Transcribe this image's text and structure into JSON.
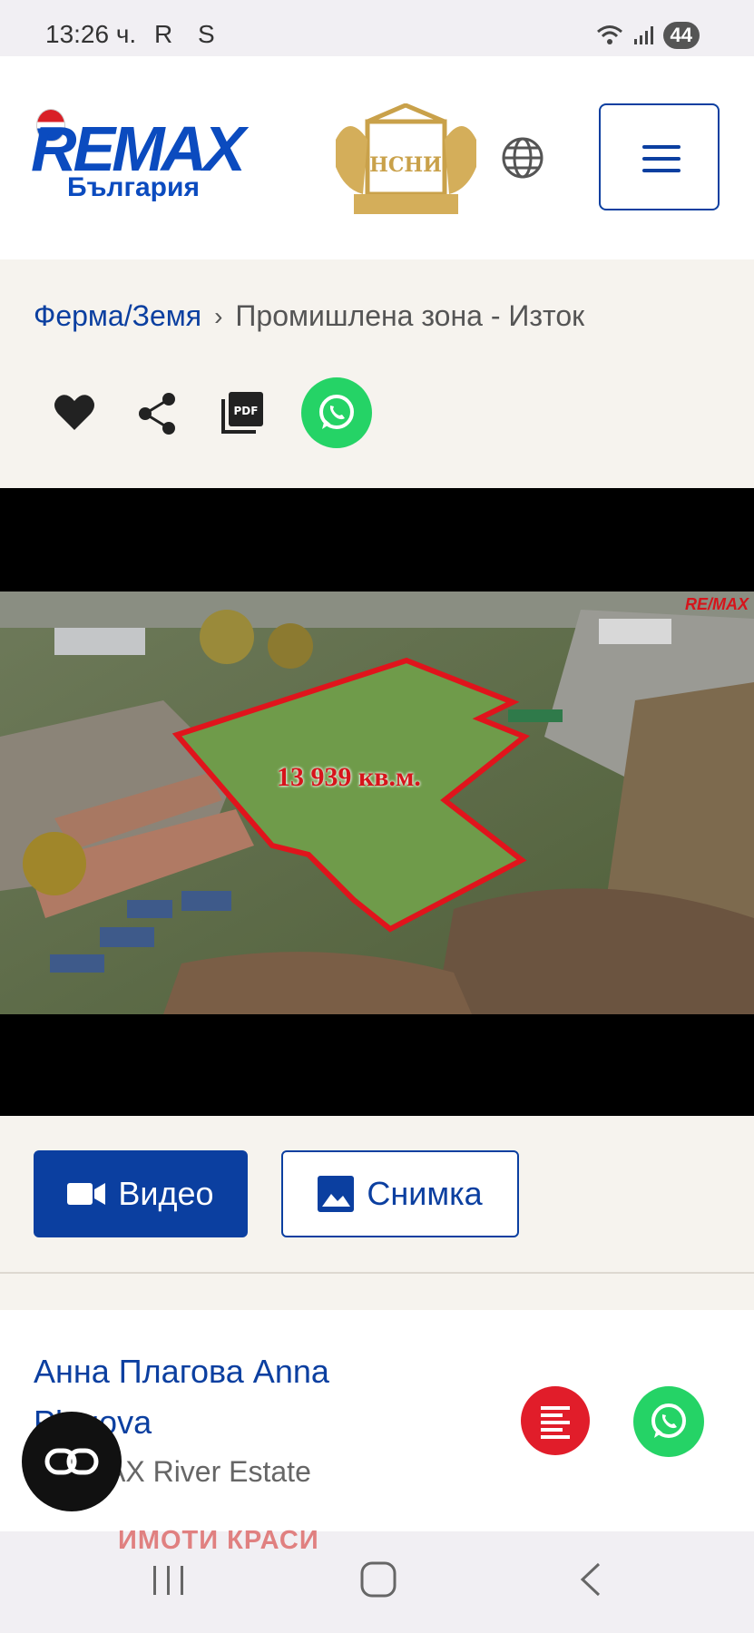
{
  "status_bar": {
    "time": "13:26 ч.",
    "left_icons": "R S",
    "battery": "44"
  },
  "header": {
    "logo_text": "REMAX",
    "logo_sub": "България",
    "crest_text": "НСНИ",
    "icons": [
      "globe-icon",
      "hamburger-menu-icon"
    ]
  },
  "breadcrumb": {
    "parent": "Ферма/Земя",
    "separator": "›",
    "current": "Промишлена зона - Изток"
  },
  "actions": {
    "icons": [
      "heart-icon",
      "share-icon",
      "pdf-icon",
      "whatsapp-icon"
    ],
    "pdf_label": "PDF"
  },
  "photo": {
    "area_label": "13 939 кв.м.",
    "watermark": "RE/MAX"
  },
  "media": {
    "video_label": "Видео",
    "photo_label": "Снимка"
  },
  "agent": {
    "name": "Анна Плагова Anna Plagova",
    "office": "RE/MAX River Estate"
  },
  "promo_text": "ИМОТИ КРАСИ",
  "colors": {
    "brand_blue": "#0b3fa0",
    "whatsapp_green": "#25d366",
    "red": "#e11d2a",
    "page_bg": "#f6f3ee"
  }
}
